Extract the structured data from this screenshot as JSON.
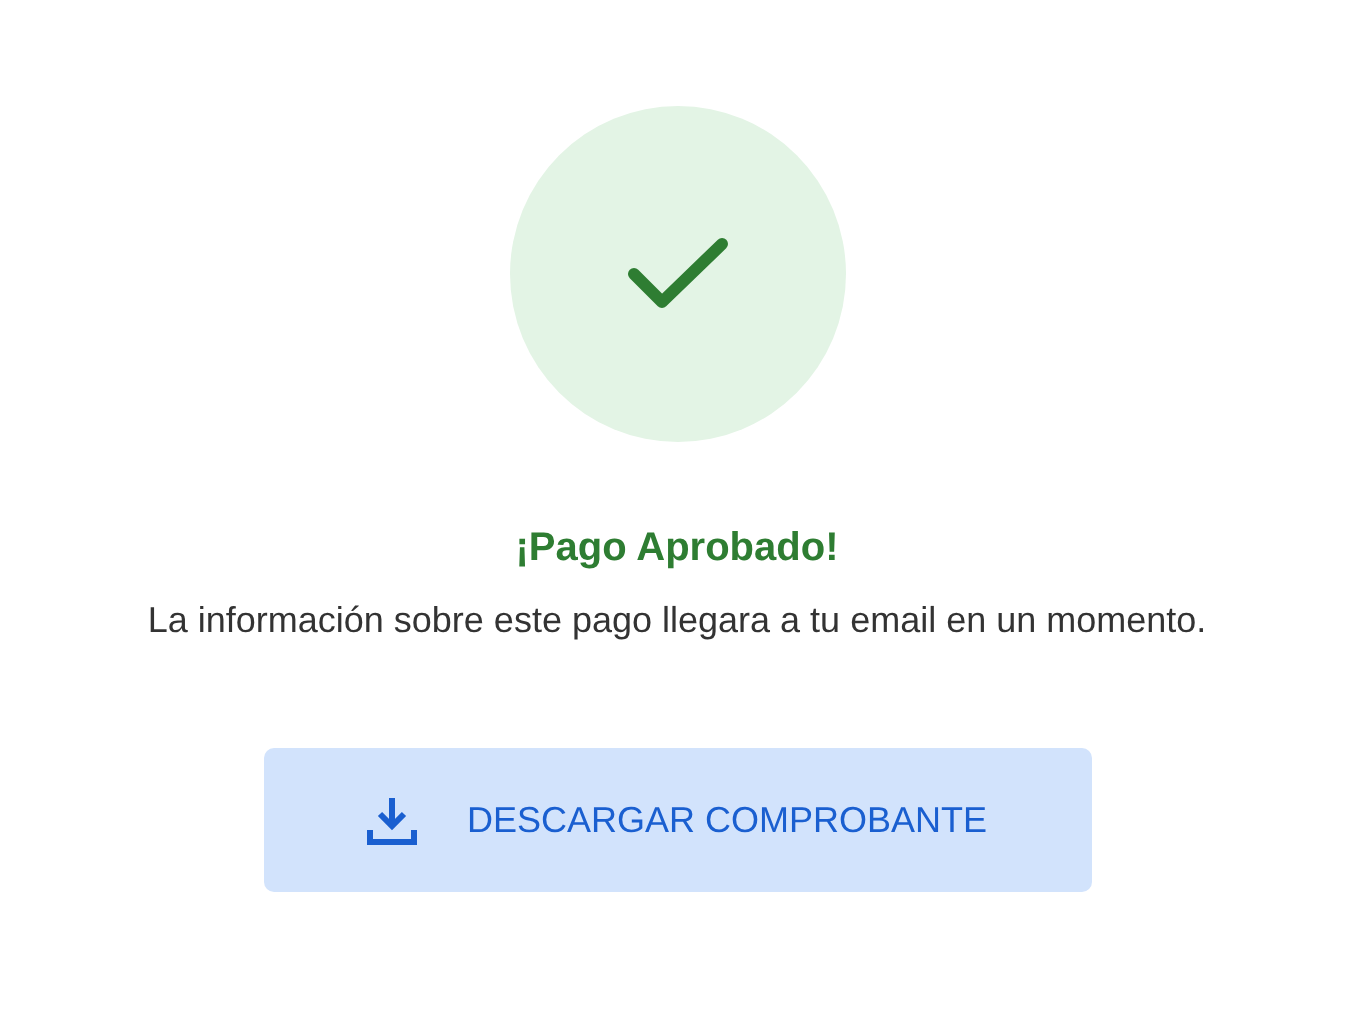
{
  "status": {
    "title": "¡Pago Aprobado!",
    "message": "La información sobre este pago llegara a tu email en un momento."
  },
  "button": {
    "label": "DESCARGAR COMPROBANTE"
  }
}
